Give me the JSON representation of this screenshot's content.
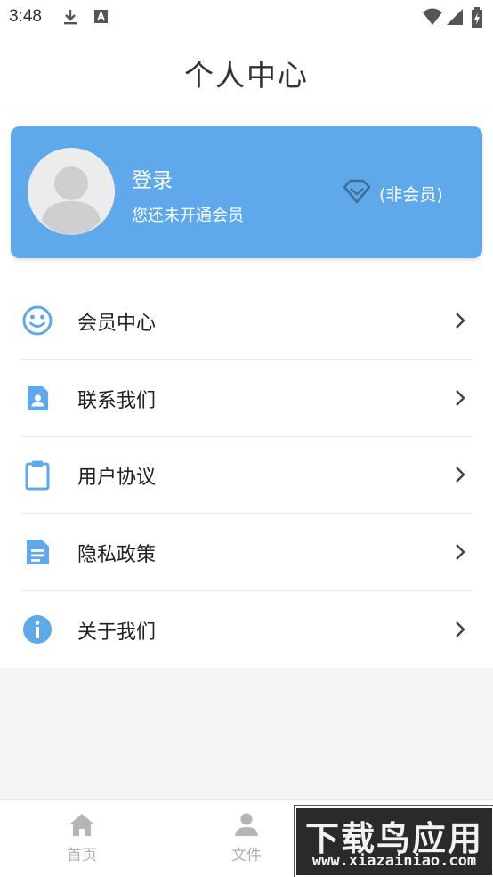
{
  "status_bar": {
    "time": "3:48",
    "icons": [
      "download-icon",
      "text-a-icon",
      "wifi-icon",
      "signal-icon",
      "battery-icon"
    ]
  },
  "header": {
    "title": "个人中心"
  },
  "profile_card": {
    "login_label": "登录",
    "subtitle": "您还未开通会员",
    "member_status": "(非会员)",
    "card_color": "#5fa9ea"
  },
  "menu": {
    "items": [
      {
        "label": "会员中心",
        "icon": "smiley-icon"
      },
      {
        "label": "联系我们",
        "icon": "contact-card-icon"
      },
      {
        "label": "用户协议",
        "icon": "clipboard-icon"
      },
      {
        "label": "隐私政策",
        "icon": "document-icon"
      },
      {
        "label": "关于我们",
        "icon": "info-icon"
      }
    ],
    "icon_color": "#5fa9ea"
  },
  "bottom_nav": {
    "items": [
      {
        "label": "首页",
        "icon": "home-icon"
      },
      {
        "label": "文件",
        "icon": "person-icon"
      }
    ]
  },
  "watermark": {
    "title": "下载鸟应用",
    "url": "www.xiazainiao.com"
  }
}
